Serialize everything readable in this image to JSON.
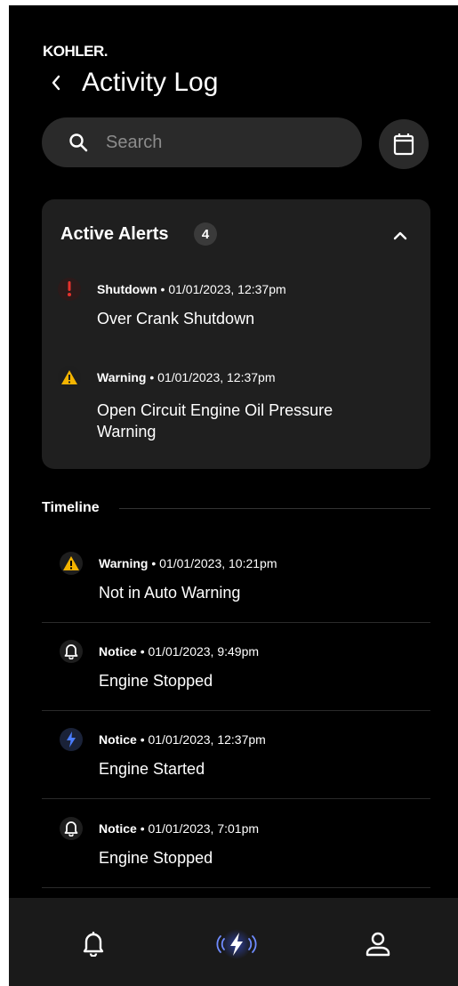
{
  "brand": "KOHLER.",
  "header": {
    "title": "Activity Log"
  },
  "search": {
    "placeholder": "Search"
  },
  "active_alerts": {
    "title": "Active Alerts",
    "count": "4",
    "items": [
      {
        "type": "Shutdown",
        "timestamp": "• 01/01/2023, 12:37pm",
        "message": "Over Crank Shutdown",
        "icon": "exclamation-icon"
      },
      {
        "type": "Warning",
        "timestamp": "• 01/01/2023, 12:37pm",
        "message": "Open Circuit Engine Oil Pressure Warning",
        "icon": "warning-triangle-icon"
      }
    ]
  },
  "timeline": {
    "title": "Timeline",
    "items": [
      {
        "type": "Warning",
        "timestamp": "• 01/01/2023, 10:21pm",
        "message": "Not in Auto Warning",
        "icon": "warning-triangle-icon"
      },
      {
        "type": "Notice",
        "timestamp": "• 01/01/2023, 9:49pm",
        "message": "Engine Stopped",
        "icon": "bell-icon"
      },
      {
        "type": "Notice",
        "timestamp": "• 01/01/2023, 12:37pm",
        "message": "Engine Started",
        "icon": "lightning-icon"
      },
      {
        "type": "Notice",
        "timestamp": "• 01/01/2023, 7:01pm",
        "message": "Engine Stopped",
        "icon": "bell-icon"
      }
    ]
  },
  "bottom_nav": {
    "items": [
      {
        "icon": "bell-icon"
      },
      {
        "icon": "generator-lightning-icon",
        "active": true
      },
      {
        "icon": "user-icon"
      }
    ]
  },
  "colors": {
    "background": "#000000",
    "card": "#1f1f1f",
    "shutdown_red": "#e5322d",
    "warning_yellow": "#f4b400",
    "accent_blue": "#4a7dff"
  }
}
